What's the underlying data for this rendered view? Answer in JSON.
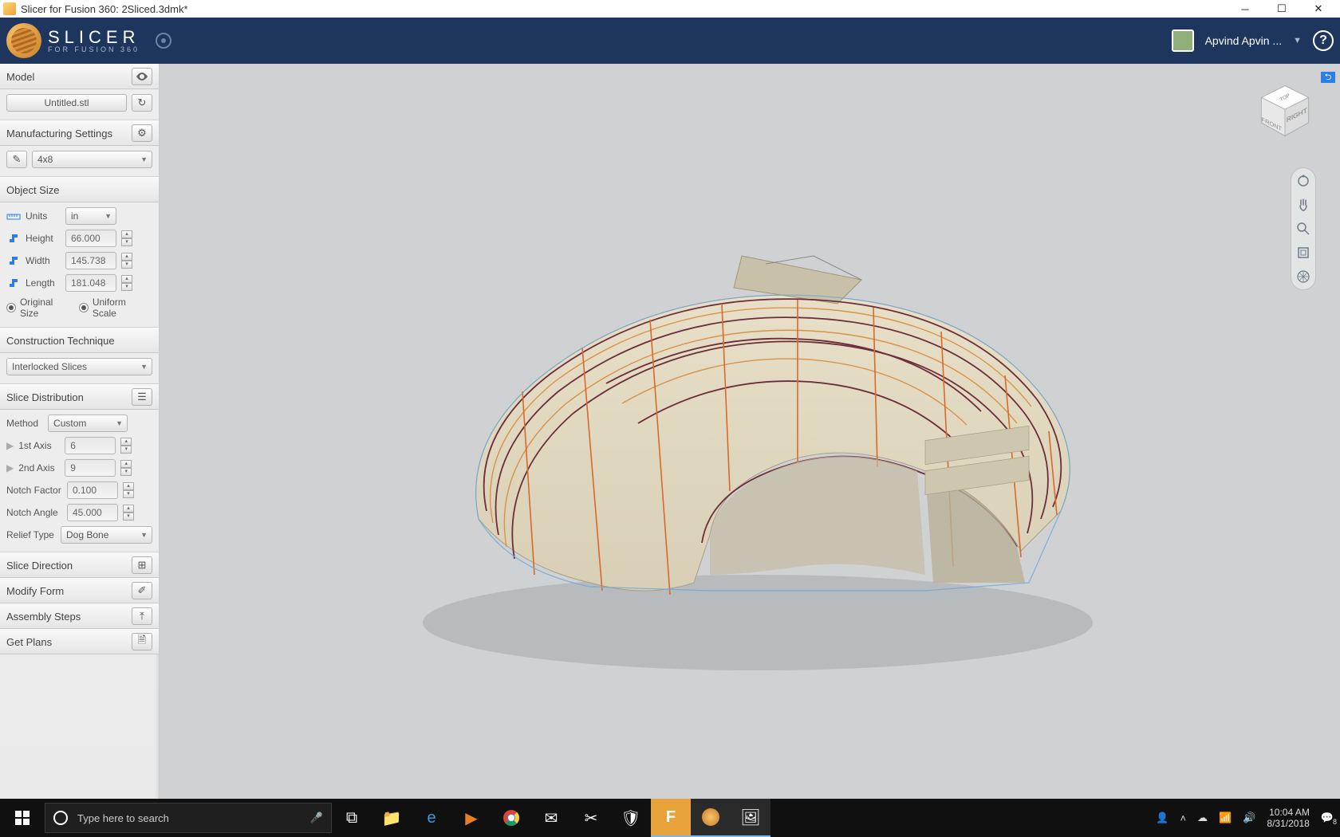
{
  "titlebar": {
    "title": "Slicer for Fusion 360: 2Sliced.3dmk*"
  },
  "topbar": {
    "logo_line1": "SLICER",
    "logo_line2": "FOR FUSION 360",
    "username": "Apvind Apvin ..."
  },
  "sidebar": {
    "model": {
      "header": "Model",
      "filename": "Untitled.stl"
    },
    "mfg": {
      "header": "Manufacturing Settings",
      "preset": "4x8"
    },
    "objsize": {
      "header": "Object Size",
      "units_label": "Units",
      "units_value": "in",
      "height_label": "Height",
      "height_value": "66.000",
      "width_label": "Width",
      "width_value": "145.738",
      "length_label": "Length",
      "length_value": "181.048",
      "original_label": "Original Size",
      "uniform_label": "Uniform Scale"
    },
    "construction": {
      "header": "Construction Technique",
      "value": "Interlocked Slices"
    },
    "slicedist": {
      "header": "Slice Distribution",
      "method_label": "Method",
      "method_value": "Custom",
      "axis1_label": "1st Axis",
      "axis1_value": "6",
      "axis2_label": "2nd Axis",
      "axis2_value": "9",
      "notch_factor_label": "Notch Factor",
      "notch_factor_value": "0.100",
      "notch_angle_label": "Notch Angle",
      "notch_angle_value": "45.000",
      "relief_label": "Relief Type",
      "relief_value": "Dog Bone"
    },
    "slicedir": {
      "header": "Slice Direction"
    },
    "modifyform": {
      "header": "Modify Form"
    },
    "assembly": {
      "header": "Assembly Steps"
    },
    "getplans": {
      "header": "Get Plans"
    }
  },
  "viewcube": {
    "front": "FRONT",
    "right": "RIGHT",
    "top": "TOP"
  },
  "taskbar": {
    "search_placeholder": "Type here to search",
    "time": "10:04 AM",
    "date": "8/31/2018",
    "notif_count": "8"
  }
}
